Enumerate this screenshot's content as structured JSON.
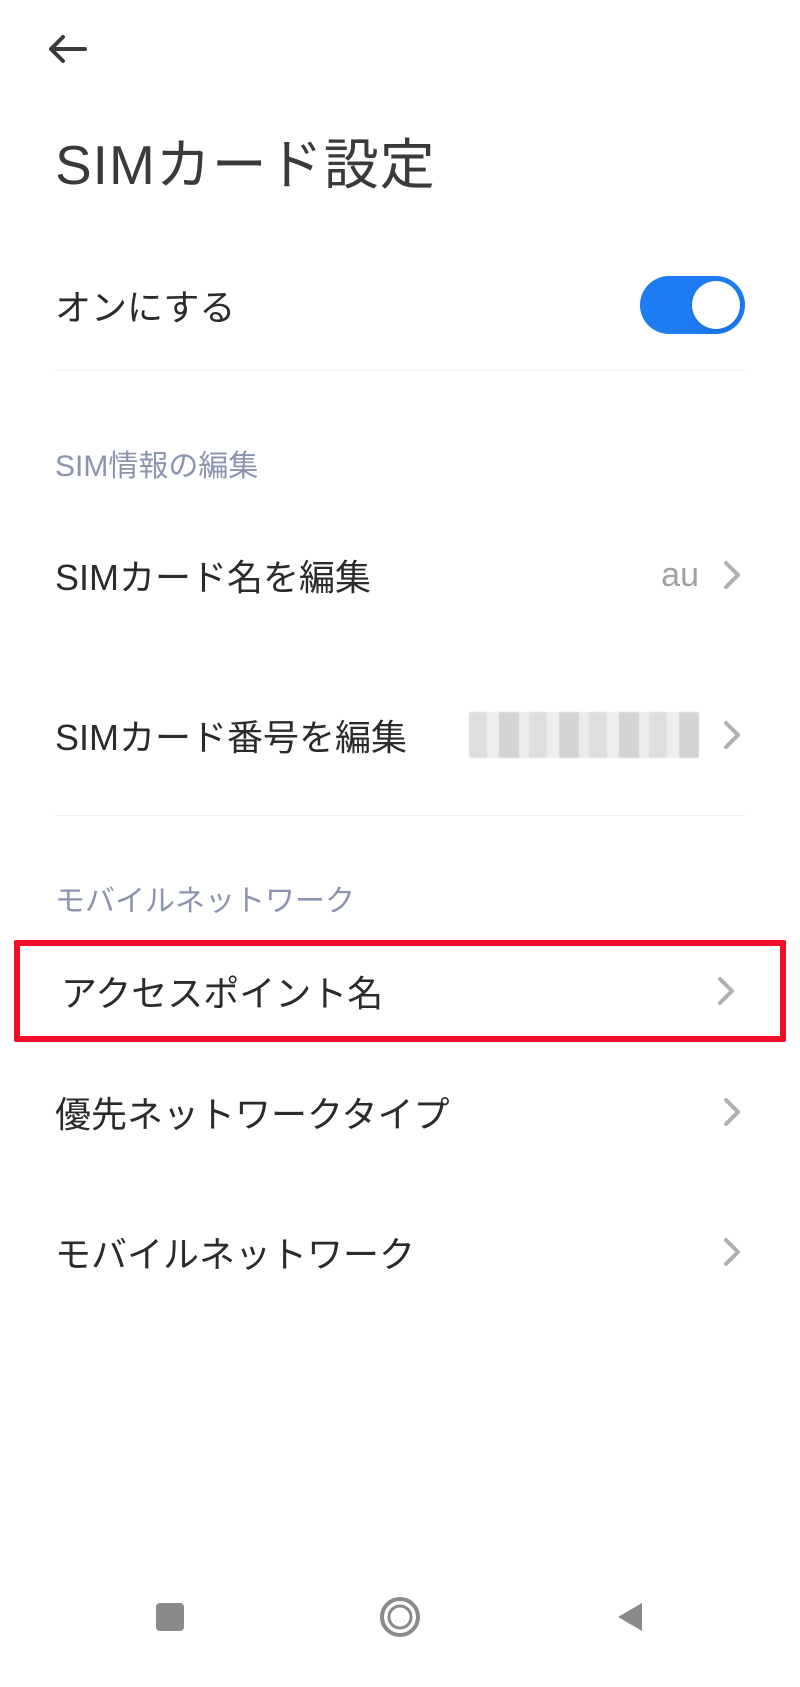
{
  "header": {
    "title": "SIMカード設定"
  },
  "enable": {
    "label": "オンにする",
    "on": true
  },
  "section_sim": {
    "header": "SIM情報の編集",
    "edit_name": {
      "label": "SIMカード名を編集",
      "value": "au"
    },
    "edit_number": {
      "label": "SIMカード番号を編集"
    }
  },
  "section_mobile": {
    "header": "モバイルネットワーク",
    "apn": {
      "label": "アクセスポイント名"
    },
    "preferred": {
      "label": "優先ネットワークタイプ"
    },
    "mobile": {
      "label": "モバイルネットワーク"
    }
  }
}
